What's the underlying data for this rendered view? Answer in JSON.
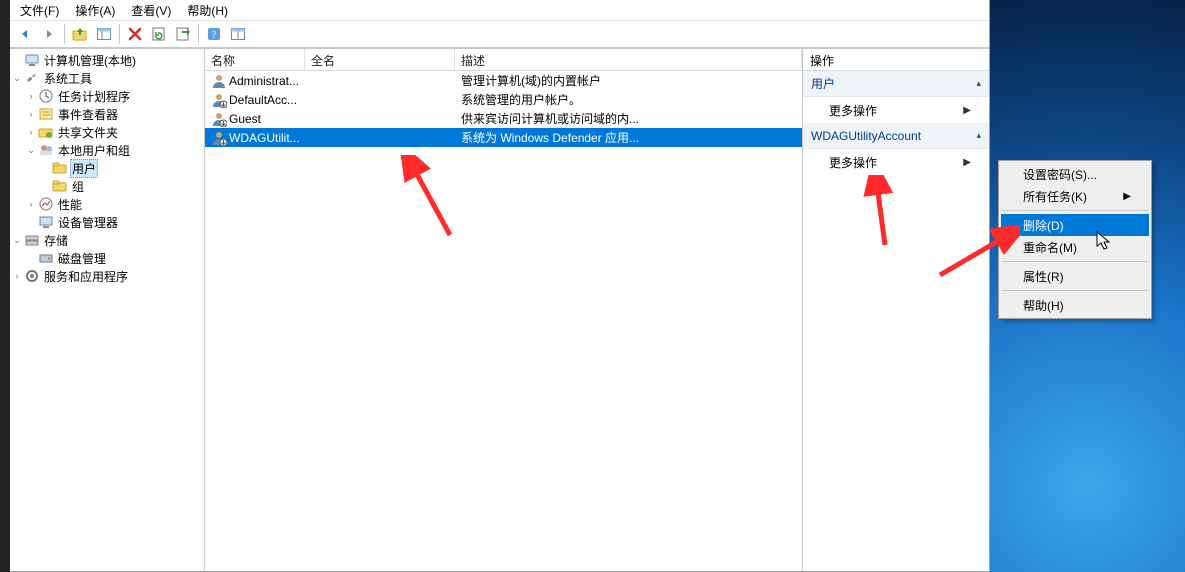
{
  "menu": {
    "file": "文件(F)",
    "action": "操作(A)",
    "view": "查看(V)",
    "help": "帮助(H)"
  },
  "tree": {
    "root": "计算机管理(本地)",
    "system_tools": "系统工具",
    "task_scheduler": "任务计划程序",
    "event_viewer": "事件查看器",
    "shared_folders": "共享文件夹",
    "local_users_groups": "本地用户和组",
    "users": "用户",
    "groups": "组",
    "performance": "性能",
    "device_manager": "设备管理器",
    "storage": "存储",
    "disk_management": "磁盘管理",
    "services_apps": "服务和应用程序"
  },
  "list": {
    "col_name": "名称",
    "col_fullname": "全名",
    "col_desc": "描述",
    "rows": [
      {
        "name": "Administrat...",
        "full": "",
        "desc": "管理计算机(域)的内置帐户",
        "disabled": false
      },
      {
        "name": "DefaultAcc...",
        "full": "",
        "desc": "系统管理的用户帐户。",
        "disabled": true
      },
      {
        "name": "Guest",
        "full": "",
        "desc": "供来宾访问计算机或访问域的内...",
        "disabled": true
      },
      {
        "name": "WDAGUtilit...",
        "full": "",
        "desc": "系统为 Windows Defender 应用...",
        "disabled": true
      }
    ],
    "selected_index": 3
  },
  "actions": {
    "header": "操作",
    "section1": "用户",
    "more1": "更多操作",
    "section2": "WDAGUtilityAccount",
    "more2": "更多操作"
  },
  "context_menu": {
    "set_password": "设置密码(S)...",
    "all_tasks": "所有任务(K)",
    "delete": "删除(D)",
    "rename": "重命名(M)",
    "properties": "属性(R)",
    "help": "帮助(H)"
  }
}
